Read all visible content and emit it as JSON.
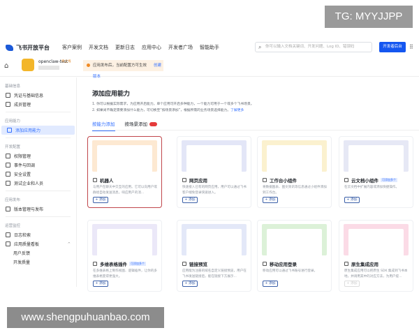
{
  "watermark_top": "TG: MYYJJPP",
  "watermark_bottom": "www.shengpuhuanbao.com",
  "header": {
    "logo": "飞书开放平台",
    "nav": [
      "客户案例",
      "开发文档",
      "更新日志",
      "应用中心",
      "开发者广场",
      "智能助手"
    ],
    "search_placeholder": "你可以输入文档关键词、开发问题、Log ID、错误码",
    "dev_console": "开发者后台"
  },
  "app": {
    "name": "openclaw-test",
    "status": "待上线",
    "notice": "应用发布后，当前配置方可生效",
    "notice_link": "创建版本"
  },
  "sidebar": {
    "groups": [
      {
        "label": "基础信息",
        "items": [
          "凭证与基础信息",
          "成员管理"
        ]
      },
      {
        "label": "应用能力",
        "items": [
          "添加应用能力"
        ]
      },
      {
        "label": "开发配置",
        "items": [
          "权限管理",
          "事件与回调",
          "安全设置",
          "测试企业和人员"
        ]
      },
      {
        "label": "应用发布",
        "items": [
          "版本管理与发布"
        ]
      },
      {
        "label": "运营监控",
        "items": [
          "日志检索",
          "应用质量看板"
        ],
        "sub": [
          "用户反馈",
          "开发质量"
        ]
      }
    ]
  },
  "main": {
    "title": "添加应用能力",
    "desc1": "1. 你可以根据实际需求，为应用开启能力。单个应用可开启多种能力，一个能力可用于一个或多个飞书场景。",
    "desc2": "2. 如果尚不确定需要添加什么能力，可切换至“按场景添加”，根据所需的业务场景选择能力。",
    "learn_more": "了解更多",
    "tabs": [
      "按能力添加",
      "按场景添加"
    ],
    "add_label": "+ 添加",
    "cards": [
      {
        "name": "机器人",
        "desc": "与用户在聊天中交互的应用。它可以向用户或群组自动发送消息，响应用户的消...",
        "badge": "",
        "color": "#fde9d2"
      },
      {
        "name": "网页应用",
        "desc": "快速接入已有的网页应用，用户可以通过飞书客户端免登录快速进入。",
        "badge": "",
        "color": "#e3e6f7"
      },
      {
        "name": "工作台小组件",
        "desc": "将数据图表、图文资讯等信息通过小组件添加到工作台。",
        "badge": "",
        "color": "#fbf1cf"
      },
      {
        "name": "云文档小组件",
        "desc": "在云文档中扩展内容或添加快捷操作。",
        "badge": "可添加多个",
        "color": "#e6e8f5"
      },
      {
        "name": "多维表格插件",
        "desc": "在多维表格上制作视图、逻辑插件，让你的多维表格变得更强大。",
        "badge": "可添加多个",
        "color": "#ebe8f8"
      },
      {
        "name": "链接预览",
        "desc": "应用能为注册的域名自定义链接预览，用户在飞书发送链接后，能在链接下方展示...",
        "badge": "",
        "color": "#e3e8f8"
      },
      {
        "name": "移动应用登录",
        "desc": "移动应用可以通过飞书账号进行登录。",
        "badge": "",
        "color": "#dcf1d8"
      },
      {
        "name": "原生集成应用",
        "desc": "原生集成应用可以把原生 SDK 集成到飞书本地，并调用其中的对应方法，为用户提...",
        "badge": "",
        "color": "#fbdbe6",
        "disabled": true
      }
    ]
  }
}
